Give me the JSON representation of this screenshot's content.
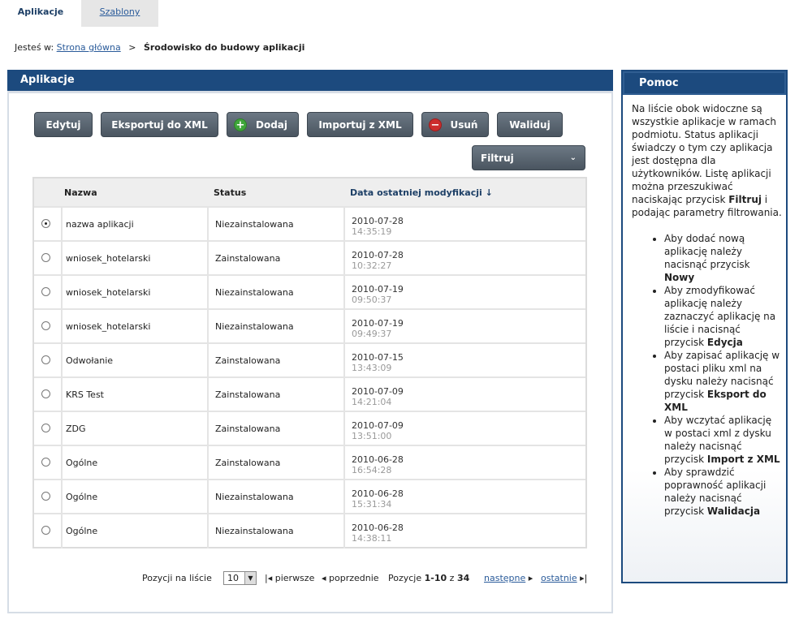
{
  "tabs": {
    "active": "Aplikacje",
    "inactive": "Szablony"
  },
  "breadcrumb": {
    "prefix": "Jesteś w:",
    "home": "Strona główna",
    "separator": ">",
    "current": "Środowisko do budowy aplikacji"
  },
  "panel": {
    "title": "Aplikacje"
  },
  "toolbar": {
    "edit": "Edytuj",
    "export": "Eksportuj do XML",
    "add": "Dodaj",
    "import": "Importuj z XML",
    "remove": "Usuń",
    "validate": "Waliduj",
    "filter": "Filtruj"
  },
  "table": {
    "headers": {
      "name": "Nazwa",
      "status": "Status",
      "date": "Data ostatniej modyfikacji ↓"
    },
    "rows": [
      {
        "name": "nazwa aplikacji",
        "status": "Niezainstalowana",
        "date": "2010-07-28",
        "time": "14:35:19",
        "selected": true
      },
      {
        "name": "wniosek_hotelarski",
        "status": "Zainstalowana",
        "date": "2010-07-28",
        "time": "10:32:27",
        "selected": false
      },
      {
        "name": "wniosek_hotelarski",
        "status": "Niezainstalowana",
        "date": "2010-07-19",
        "time": "09:50:37",
        "selected": false
      },
      {
        "name": "wniosek_hotelarski",
        "status": "Niezainstalowana",
        "date": "2010-07-19",
        "time": "09:49:37",
        "selected": false
      },
      {
        "name": "Odwołanie",
        "status": "Zainstalowana",
        "date": "2010-07-15",
        "time": "13:43:09",
        "selected": false
      },
      {
        "name": "KRS Test",
        "status": "Zainstalowana",
        "date": "2010-07-09",
        "time": "14:21:04",
        "selected": false
      },
      {
        "name": "ZDG",
        "status": "Zainstalowana",
        "date": "2010-07-09",
        "time": "13:51:00",
        "selected": false
      },
      {
        "name": "Ogólne",
        "status": "Zainstalowana",
        "date": "2010-06-28",
        "time": "16:54:28",
        "selected": false
      },
      {
        "name": "Ogólne",
        "status": "Niezainstalowana",
        "date": "2010-06-28",
        "time": "15:31:34",
        "selected": false
      },
      {
        "name": "Ogólne",
        "status": "Niezainstalowana",
        "date": "2010-06-28",
        "time": "14:38:11",
        "selected": false
      }
    ]
  },
  "pager": {
    "per_page_label": "Pozycji na liście",
    "per_page_value": "10",
    "first": "pierwsze",
    "prev": "poprzednie",
    "range_prefix": "Pozycje",
    "range": "1-10",
    "of": "z",
    "total": "34",
    "next": "następne",
    "last": "ostatnie"
  },
  "help": {
    "title": "Pomoc",
    "intro_1": "Na liście obok widoczne są wszystkie aplikacje w ramach podmiotu. Status aplikacji świadczy o tym czy aplikacja jest dostępna dla użytkowników. Listę aplikacji można przeszukiwać naciskając przycisk ",
    "intro_bold": "Filtruj",
    "intro_2": " i podając parametry filtrowania.",
    "items": [
      {
        "text": "Aby dodać nową aplikację należy nacisnąć przycisk ",
        "bold": "Nowy"
      },
      {
        "text": "Aby zmodyfikować aplikację należy zaznaczyć aplikację na liście i nacisnąć przycisk ",
        "bold": "Edycja"
      },
      {
        "text": "Aby zapisać aplikację w postaci pliku xml na dysku należy nacisnąć przycisk ",
        "bold": "Eksport do XML"
      },
      {
        "text": "Aby wczytać aplikację w postaci xml z dysku należy nacisnąć przycisk ",
        "bold": "Import z XML"
      },
      {
        "text": "Aby sprawdzić poprawność aplikacji należy nacisnąć przycisk ",
        "bold": "Walidacja"
      }
    ]
  }
}
